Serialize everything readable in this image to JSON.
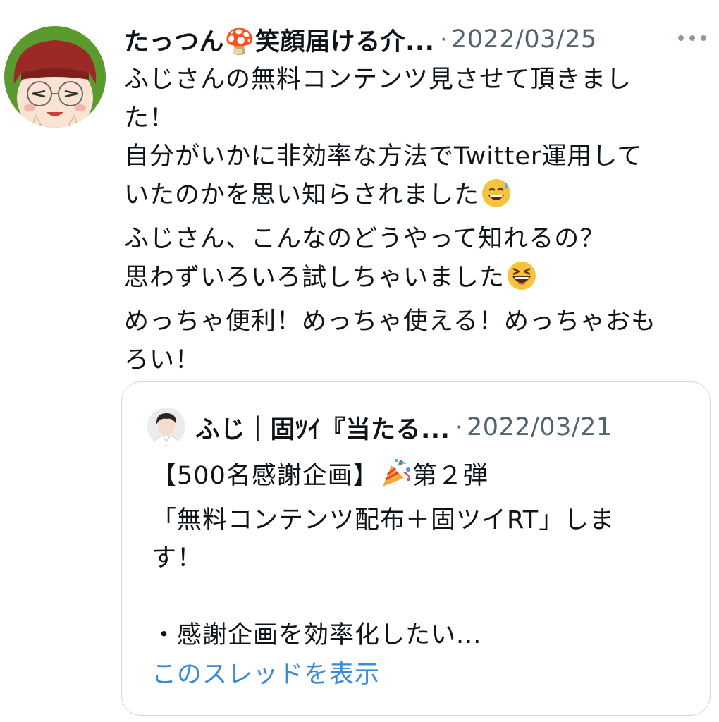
{
  "tweet": {
    "author_name": "たっつん🍄笑顔届ける介...",
    "separator": "·",
    "date": "2022/03/25",
    "lines": [
      "ふじさんの無料コンテンツ見させて頂きまし",
      "た！",
      "自分がいかに非効率な方法でTwitter運用して",
      "いたのかを思い知らされました",
      "ふじさん、こんなのどうやって知れるの？",
      "思わずいろいろ試しちゃいました",
      "めっちゃ便利！めっちゃ使える！めっちゃおも",
      "ろい！"
    ],
    "emojis": {
      "line4": "sweat-smile-emoji",
      "line6": "laughing-emoji"
    }
  },
  "quote": {
    "author_name": "ふじ｜固ﾂｲ『当たる...",
    "separator": "·",
    "date": "2022/03/21",
    "lines": [
      "【500名感謝企画】",
      "第２弾",
      "「無料コンテンツ配布＋固ツイRT」しま",
      "す！",
      "",
      "・感謝企画を効率化したい..."
    ],
    "show_thread": "このスレッドを表示"
  },
  "colors": {
    "text": "#0f1419",
    "secondary": "#536471",
    "link": "#3a8ad6",
    "border": "#cfd9de"
  }
}
